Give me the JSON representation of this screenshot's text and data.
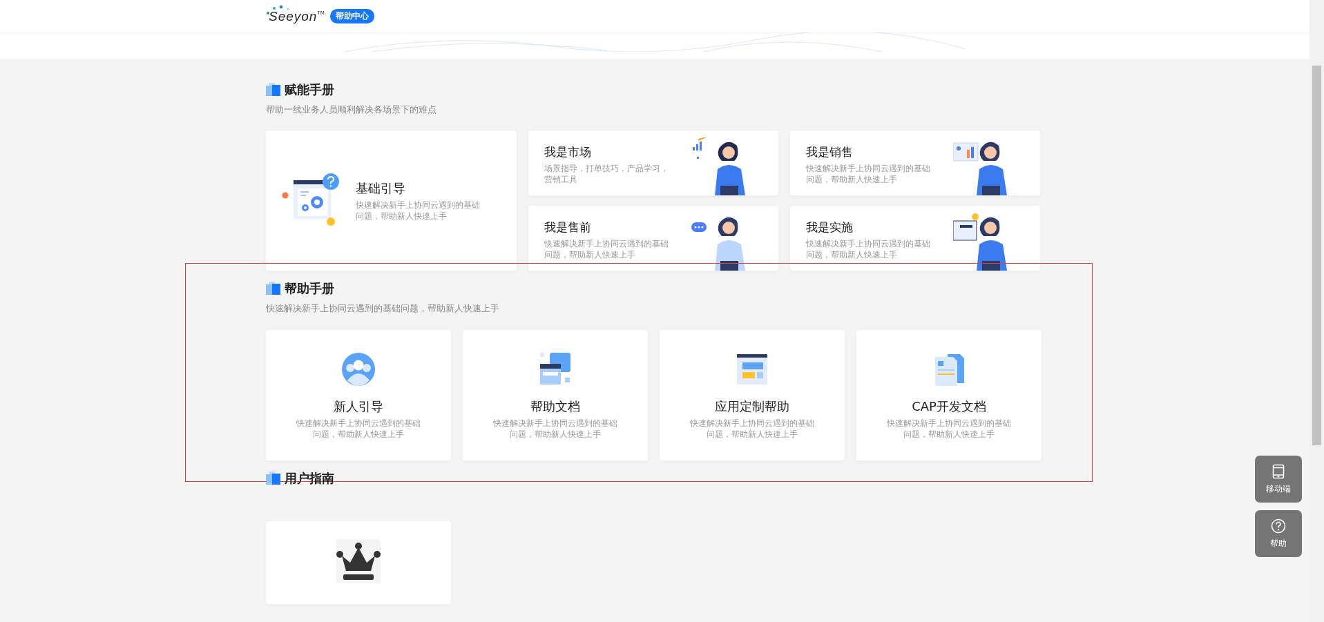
{
  "header": {
    "logo": "Seeyon",
    "trademark": "TM",
    "badge": "帮助中心"
  },
  "sections": [
    {
      "title": "赋能手册",
      "subtitle": "帮助一线业务人员顺利解决各场景下的难点",
      "kind": "mosaic",
      "cards": [
        {
          "title": "基础引导",
          "desc": "快速解决新手上协同云遇到的基础问题，帮助新人快速上手"
        },
        {
          "title": "我是市场",
          "desc": "场景指导，打单技巧，产品学习，营销工具"
        },
        {
          "title": "我是销售",
          "desc": "快速解决新手上协同云遇到的基础问题，帮助新人快速上手"
        },
        {
          "title": "我是售前",
          "desc": "快速解决新手上协同云遇到的基础问题，帮助新人快速上手"
        },
        {
          "title": "我是实施",
          "desc": "快速解决新手上协同云遇到的基础问题，帮助新人快速上手"
        }
      ]
    },
    {
      "title": "帮助手册",
      "subtitle": "快速解决新手上协同云遇到的基础问题，帮助新人快速上手",
      "kind": "row",
      "highlighted": true,
      "cards": [
        {
          "title": "新人引导",
          "desc": "快速解决新手上协同云遇到的基础问题，帮助新人快速上手"
        },
        {
          "title": "帮助文档",
          "desc": "快速解决新手上协同云遇到的基础问题，帮助新人快速上手"
        },
        {
          "title": "应用定制帮助",
          "desc": "快速解决新手上协同云遇到的基础问题，帮助新人快速上手"
        },
        {
          "title": "CAP开发文档",
          "desc": "快速解决新手上协同云遇到的基础问题，帮助新人快速上手"
        }
      ]
    },
    {
      "title": "用户指南",
      "kind": "guide",
      "cards": [
        {
          "kind": "icon"
        }
      ]
    }
  ],
  "floating_buttons": [
    {
      "label": "移动端"
    },
    {
      "label": "帮助"
    }
  ]
}
